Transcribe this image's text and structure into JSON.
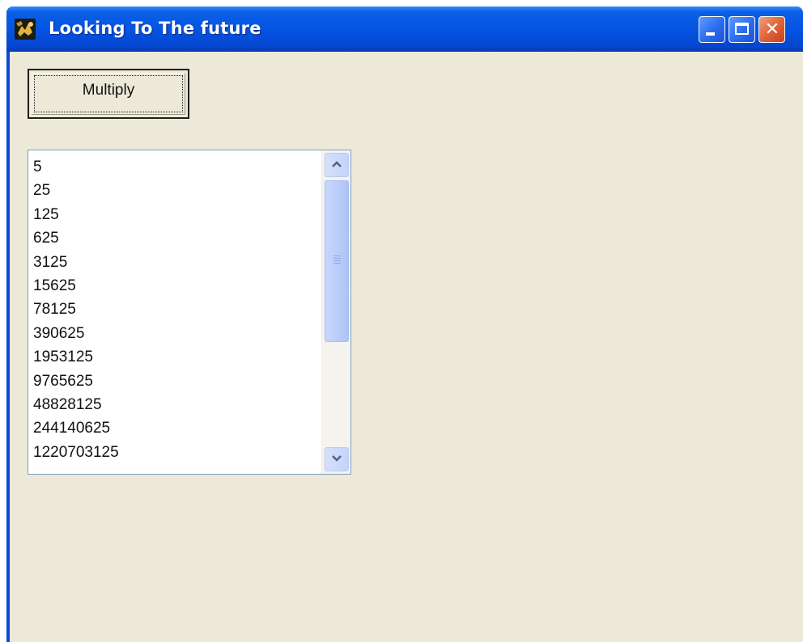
{
  "window": {
    "title": "Looking To The future",
    "icon": "app-icon"
  },
  "titlebar_buttons": {
    "minimize_icon": "minimize-icon",
    "maximize_icon": "maximize-icon",
    "close_icon": "close-icon",
    "close_glyph": "✕"
  },
  "toolbar": {
    "multiply_label": "Multiply"
  },
  "list": {
    "items": [
      "5",
      "25",
      "125",
      "625",
      "3125",
      "15625",
      "78125",
      "390625",
      "1953125",
      "9765625",
      "48828125",
      "244140625",
      "1220703125"
    ]
  },
  "scrollbar": {
    "up_icon": "chevron-up-icon",
    "down_icon": "chevron-down-icon"
  },
  "colors": {
    "titlebar": "#0554e3",
    "window_face": "#ece9d8",
    "close_button": "#e0643c",
    "list_border": "#7f9db9"
  }
}
